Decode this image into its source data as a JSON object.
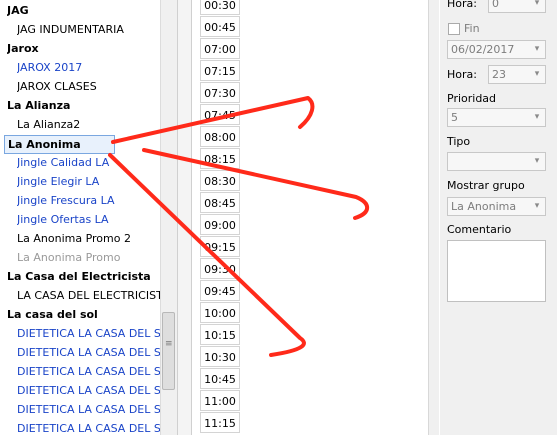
{
  "tree": {
    "rows": [
      {
        "text": "JAG",
        "kind": "group"
      },
      {
        "text": "JAG INDUMENTARIA",
        "kind": "item",
        "color": "black"
      },
      {
        "text": "Jarox",
        "kind": "group"
      },
      {
        "text": "JAROX 2017",
        "kind": "item",
        "color": "blue"
      },
      {
        "text": "JAROX CLASES",
        "kind": "item",
        "color": "black"
      },
      {
        "text": "La Alianza",
        "kind": "group"
      },
      {
        "text": "La Alianza2",
        "kind": "item",
        "color": "black"
      },
      {
        "text": "La Anonima",
        "kind": "group",
        "selected": true
      },
      {
        "text": "Jingle Calidad LA",
        "kind": "item",
        "color": "blue"
      },
      {
        "text": "Jingle Elegir LA",
        "kind": "item",
        "color": "blue"
      },
      {
        "text": "Jingle Frescura LA",
        "kind": "item",
        "color": "blue"
      },
      {
        "text": "Jingle Ofertas LA",
        "kind": "item",
        "color": "blue"
      },
      {
        "text": "La Anonima Promo 2",
        "kind": "item",
        "color": "black"
      },
      {
        "text": "La Anonima Promo",
        "kind": "item",
        "color": "grey"
      },
      {
        "text": "La Casa del Electricista",
        "kind": "group"
      },
      {
        "text": "LA CASA DEL ELECTRICISTA",
        "kind": "item",
        "color": "black"
      },
      {
        "text": "La casa del sol",
        "kind": "group"
      },
      {
        "text": "DIETETICA LA CASA DEL SOL",
        "kind": "item",
        "color": "blue"
      },
      {
        "text": "DIETETICA LA CASA DEL SOL",
        "kind": "item",
        "color": "blue"
      },
      {
        "text": "DIETETICA LA CASA DEL SOL",
        "kind": "item",
        "color": "blue"
      },
      {
        "text": "DIETETICA LA CASA DEL SOL",
        "kind": "item",
        "color": "blue"
      },
      {
        "text": "DIETETICA LA CASA DEL SOL",
        "kind": "item",
        "color": "blue"
      },
      {
        "text": "DIETETICA LA CASA DEL SOL",
        "kind": "item",
        "color": "blue"
      }
    ]
  },
  "times": [
    "00:30",
    "00:45",
    "07:00",
    "07:15",
    "07:30",
    "07:45",
    "08:00",
    "08:15",
    "08:30",
    "08:45",
    "09:00",
    "09:15",
    "09:30",
    "09:45",
    "10:00",
    "10:15",
    "10:30",
    "10:45",
    "11:00",
    "11:15"
  ],
  "panel": {
    "hora_label": "Hora:",
    "hora_value": "0",
    "fin_label": "Fin",
    "fecha_value": "06/02/2017",
    "hora2_label": "Hora:",
    "hora2_value": "23",
    "prioridad_label": "Prioridad",
    "prioridad_value": "5",
    "tipo_label": "Tipo",
    "tipo_value": "",
    "mostrar_label": "Mostrar grupo",
    "mostrar_value": "La Anonima",
    "comentario_label": "Comentario"
  },
  "colors": {
    "annotation": "#ff2a1a",
    "link_blue": "#1a44c8",
    "selection": "#e8f1fc"
  }
}
